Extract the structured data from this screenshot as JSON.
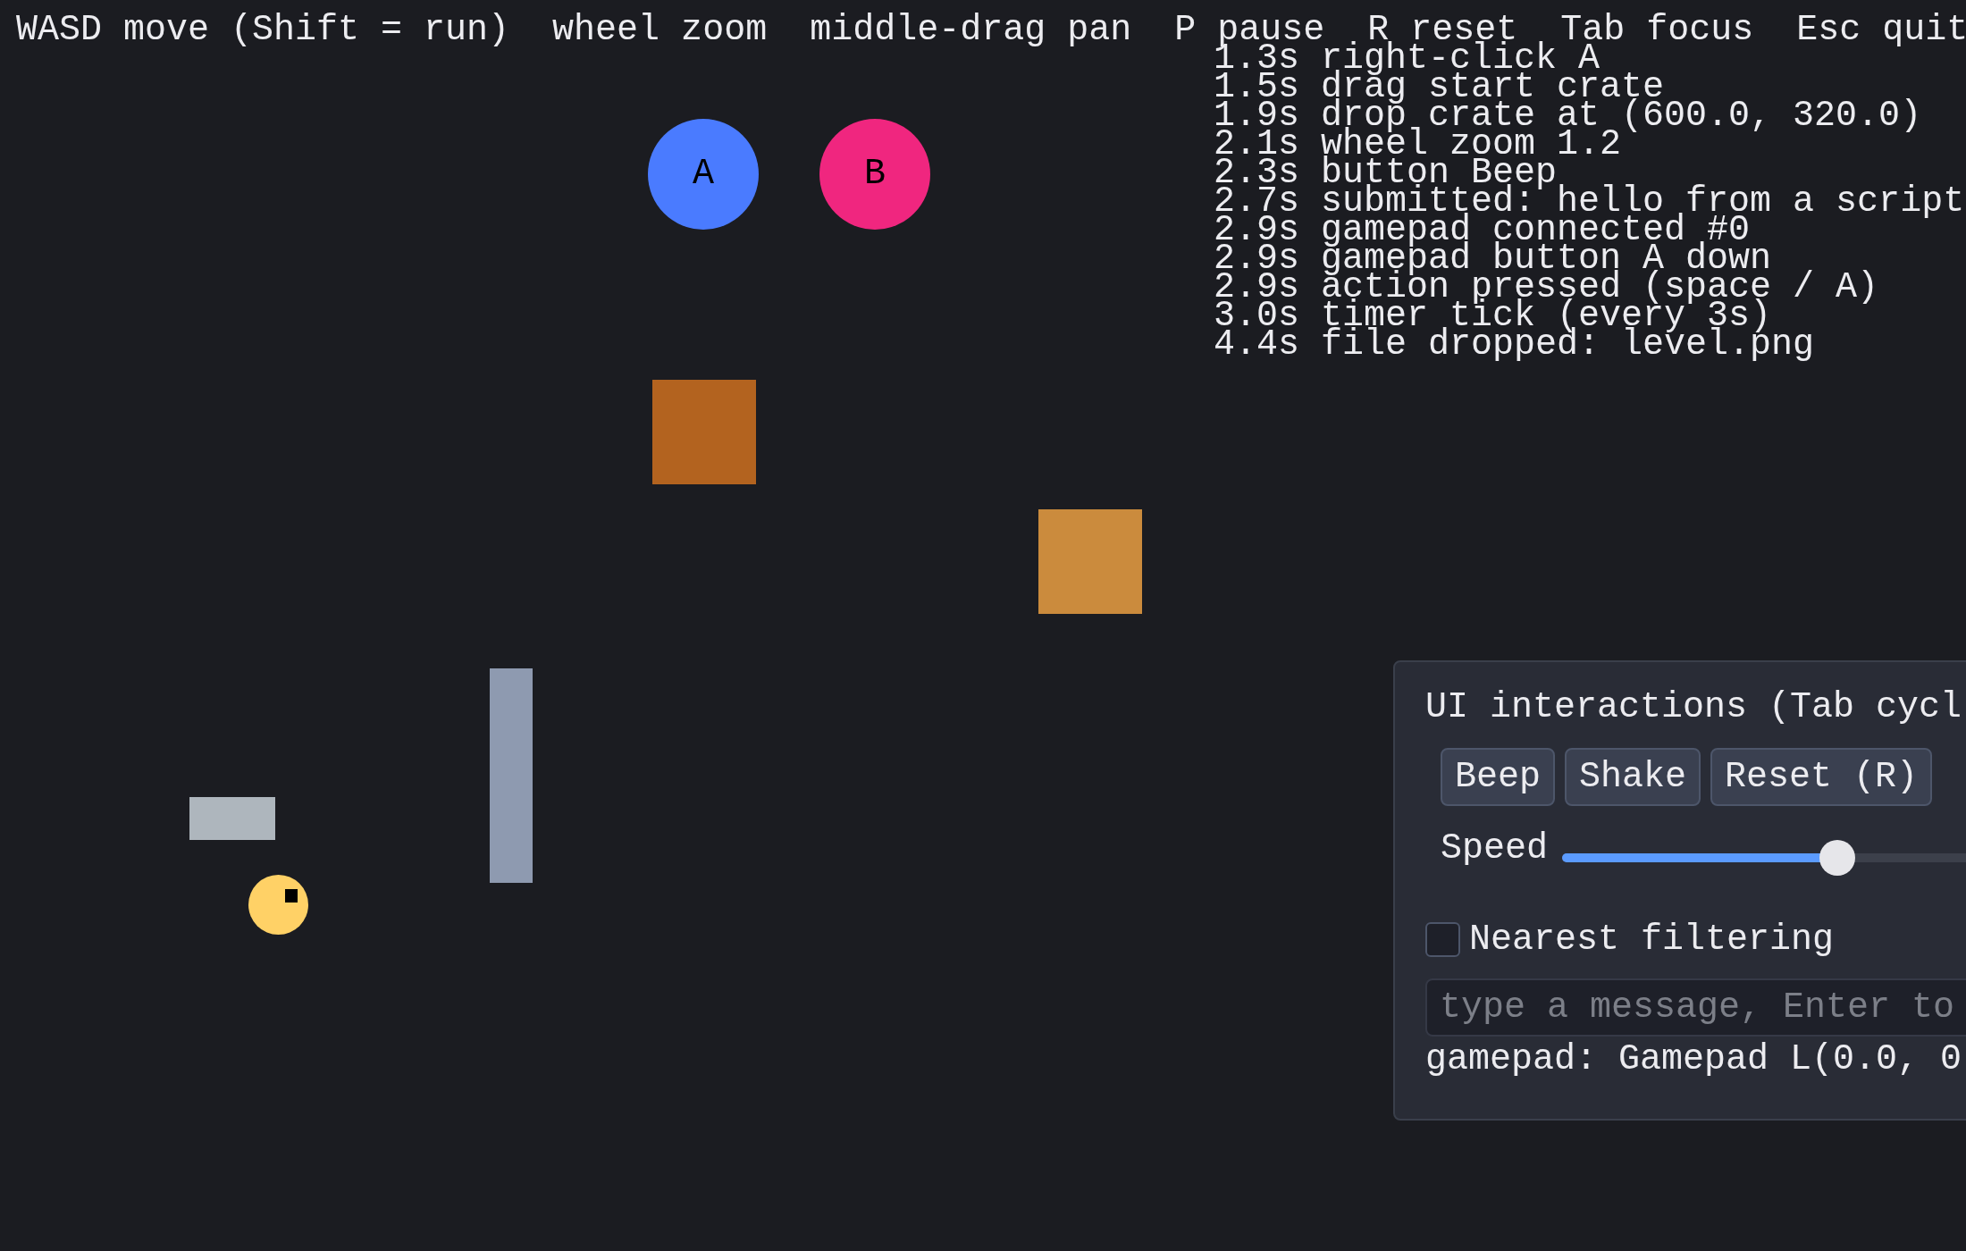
{
  "hud": {
    "help": "WASD move (Shift = run)  wheel zoom  middle-drag pan  P pause  R reset  Tab focus  Esc quit"
  },
  "log": [
    "1.3s right-click A",
    "1.5s drag start crate",
    "1.9s drop crate at (600.0, 320.0)",
    "2.1s wheel zoom 1.2",
    "2.3s button Beep",
    "2.7s submitted: hello from a script",
    "2.9s gamepad connected #0",
    "2.9s gamepad button A down",
    "2.9s action pressed (space / A)",
    "3.0s timer tick (every 3s)",
    "4.4s file dropped: level.png"
  ],
  "scene": {
    "balls": [
      {
        "label": "A",
        "color": "#4a7bff"
      },
      {
        "label": "B",
        "color": "#f0267f"
      }
    ],
    "crates": [
      {
        "color": "#b3631f"
      },
      {
        "color": "#cb8b3d"
      }
    ]
  },
  "panel": {
    "title": "UI interactions (Tab cycl",
    "buttons": [
      "Beep",
      "Shake",
      "Reset (R)"
    ],
    "slider": {
      "label": "Speed",
      "level": 0.65
    },
    "checkbox": {
      "label": "Nearest filtering",
      "checked": false
    },
    "input": {
      "placeholder": "type a message, Enter to"
    },
    "status": "gamepad: Gamepad L(0.0, 0"
  }
}
